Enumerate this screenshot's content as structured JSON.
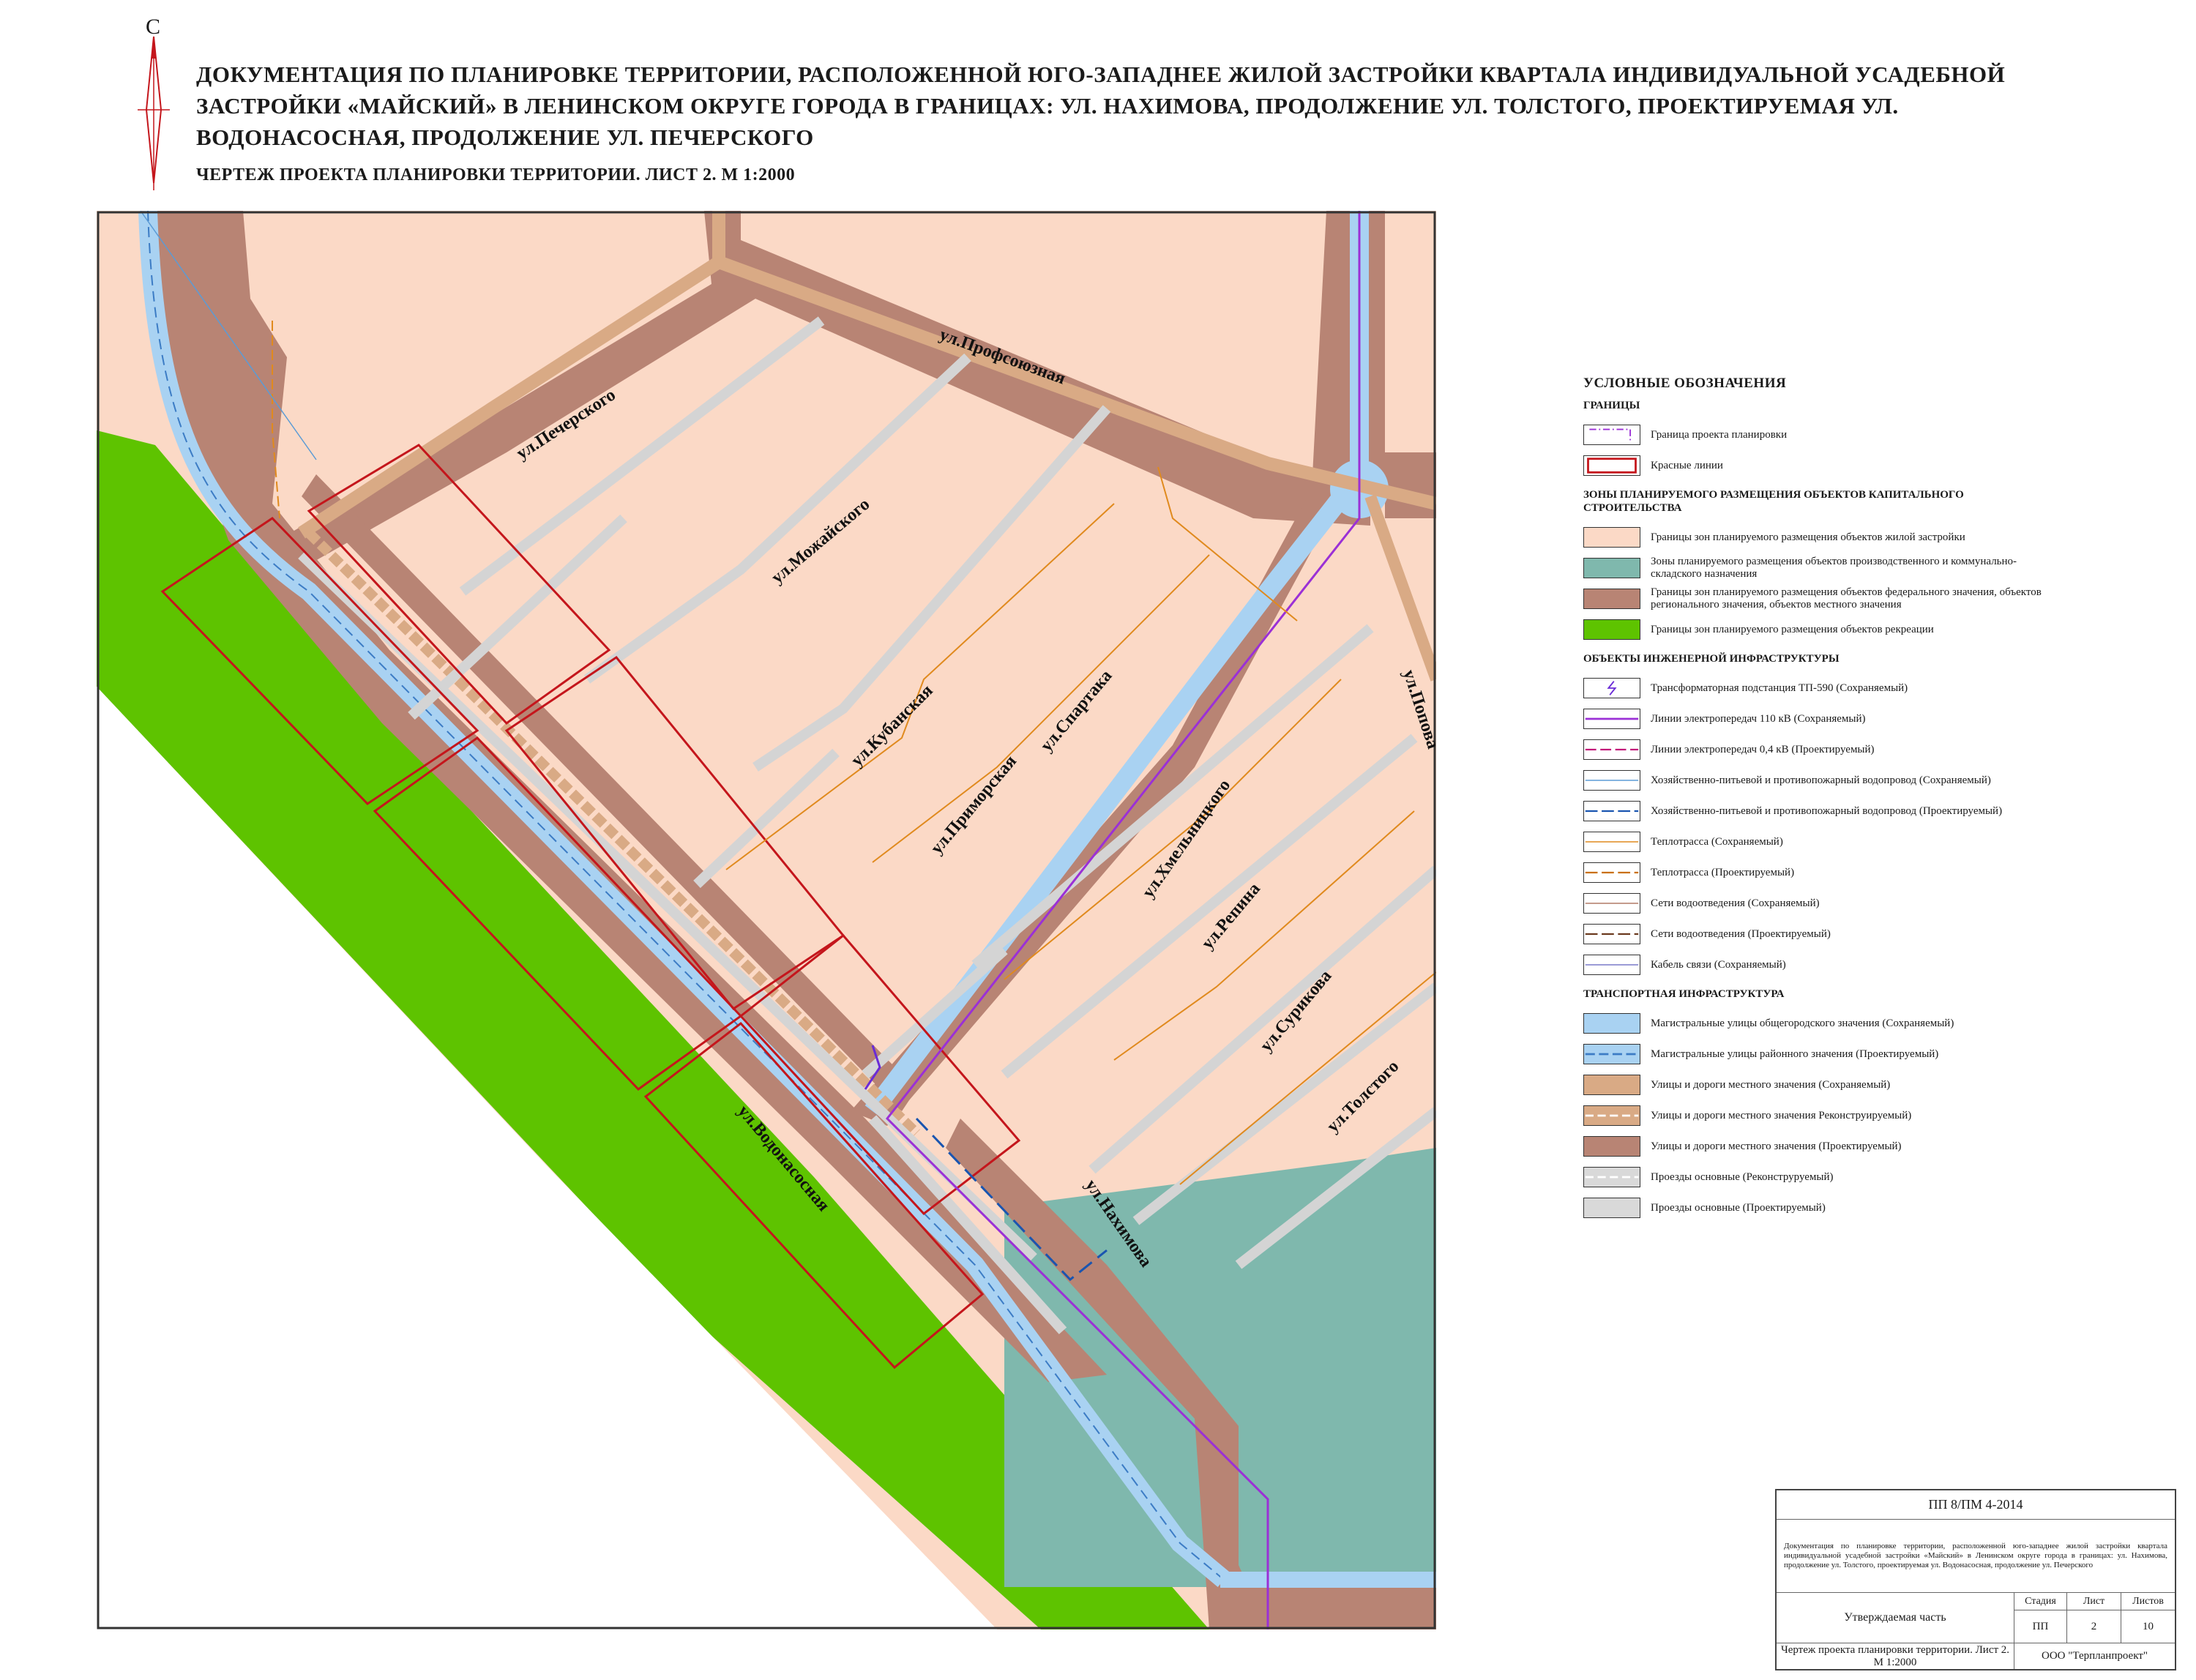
{
  "document": {
    "title": "ДОКУМЕНТАЦИЯ ПО ПЛАНИРОВКЕ ТЕРРИТОРИИ, РАСПОЛОЖЕННОЙ ЮГО-ЗАПАДНЕЕ ЖИЛОЙ ЗАСТРОЙКИ КВАРТАЛА ИНДИВИДУАЛЬНОЙ УСАДЕБНОЙ ЗАСТРОЙКИ «МАЙСКИЙ» В ЛЕНИНСКОМ ОКРУГЕ ГОРОДА В ГРАНИЦАХ: УЛ. НАХИМОВА, ПРОДОЛЖЕНИЕ УЛ. ТОЛСТОГО, ПРОЕКТИРУЕМАЯ УЛ. ВОДОНАСОСНАЯ, ПРОДОЛЖЕНИЕ УЛ. ПЕЧЕРСКОГО",
    "subtitle": "ЧЕРТЕЖ ПРОЕКТА ПЛАНИРОВКИ ТЕРРИТОРИИ. ЛИСТ 2. М 1:2000",
    "north_letter": "С"
  },
  "map": {
    "colors": {
      "residential": "#fbd9c6",
      "industrial": "#7fb8ad",
      "road_zone": "#b88474",
      "recreation": "#5ec300",
      "main_road": "#a9d2f2",
      "local_road": "#d9aa85",
      "driveway": "#d9d9d9",
      "red_line": "#c4161c",
      "power_110": "#9b30d6",
      "heat": "#e08a1e",
      "water": "#1a55b0"
    },
    "streets": {
      "pechersky": "ул.Печерского",
      "mozhaysky": "ул.Можайского",
      "kubanskaya": "ул.Кубанская",
      "primorskaya": "ул.Приморская",
      "profsoyuznaya": "ул.Профсоюзная",
      "spartaka": "ул.Спартака",
      "khmelnitskogo": "ул.Хмельницкого",
      "repina": "ул.Репина",
      "surikova": "ул.Сурикова",
      "tolstogo": "ул.Толстого",
      "popova": "ул.Попова",
      "nakhimova": "ул.Нахимова",
      "vodonasosnaya": "ул.Водонасосная"
    }
  },
  "legend": {
    "title": "УСЛОВНЫЕ ОБОЗНАЧЕНИЯ",
    "sections": {
      "borders": "ГРАНИЦЫ",
      "zones": "ЗОНЫ ПЛАНИРУЕМОГО РАЗМЕЩЕНИЯ ОБЪЕКТОВ КАПИТАЛЬНОГО СТРОИТЕЛЬСТВА",
      "engineering": "ОБЪЕКТЫ ИНЖЕНЕРНОЙ ИНФРАСТРУКТУРЫ",
      "transport": "ТРАНСПОРТНАЯ ИНФРАСТРУКТУРА"
    },
    "items": {
      "plan_border": "Граница проекта планировки",
      "red_lines": "Красные линии",
      "residential_zone": "Границы зон планируемого размещения объектов жилой застройки",
      "industrial_zone": "Зоны планируемого размещения объектов производственного и коммунально-складского назначения",
      "federal_zone": "Границы зон планируемого размещения объектов федерального значения, объектов регионального значения, объектов местного значения",
      "recreation_zone": "Границы зон планируемого размещения объектов рекреации",
      "substation": "Трансформаторная подстанция ТП-590 (Сохраняемый)",
      "power_110": "Линии электропередач 110 кВ (Сохраняемый)",
      "power_04": "Линии электропередач 0,4 кВ (Проектируемый)",
      "water_existing": "Хозяйственно-питьевой и противопожарный водопровод (Сохраняемый)",
      "water_planned": "Хозяйственно-питьевой и противопожарный водопровод (Проектируемый)",
      "heat_existing": "Теплотрасса (Сохраняемый)",
      "heat_planned": "Теплотрасса (Проектируемый)",
      "sewer_existing": "Сети водоотведения (Сохраняемый)",
      "sewer_planned": "Сети водоотведения (Проектируемый)",
      "cable": "Кабель связи (Сохраняемый)",
      "main_city": "Магистральные улицы общегородского значения (Сохраняемый)",
      "main_district": "Магистральные улицы районного значения (Проектируемый)",
      "local_existing": "Улицы и дороги местного значения (Сохраняемый)",
      "local_reconstructed": "Улицы и дороги местного значения Реконструируемый)",
      "local_planned": "Улицы и дороги местного значения (Проектируемый)",
      "driveway_reconstructed": "Проезды основные (Реконструруемый)",
      "driveway_planned": "Проезды основные (Проектируемый)"
    }
  },
  "stamp": {
    "code": "ПП 8/ПМ 4-2014",
    "description": "Документация по планировке территории, расположенной юго-западнее жилой застройки квартала индивидуальной усадебной застройки «Майский» в Ленинском округе города в границах: ул. Нахимова, продолжение ул. Толстого, проектируемая ул. Водонасосная, продолжение ул. Печерского",
    "part": "Утверждаемая часть",
    "headers": {
      "stage": "Стадия",
      "sheet": "Лист",
      "sheets": "Листов"
    },
    "values": {
      "stage": "ПП",
      "sheet": "2",
      "sheets": "10"
    },
    "drawing": "Чертеж проекта планировки территории. Лист 2. М 1:2000",
    "organization": "ООО \"Терпланпроект\""
  }
}
